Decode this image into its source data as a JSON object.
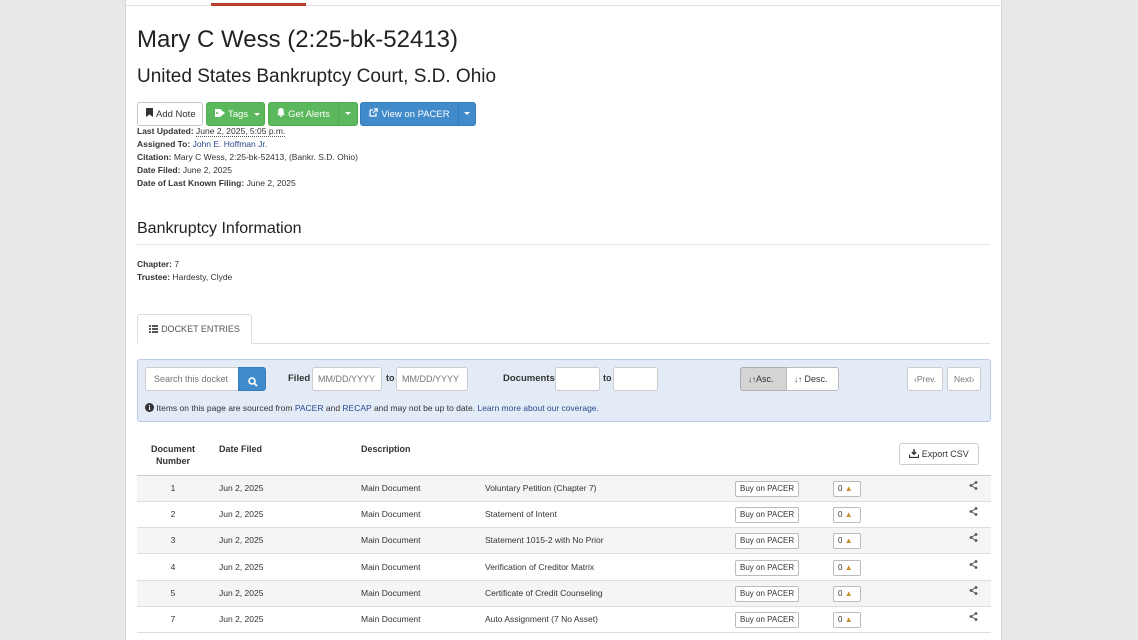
{
  "case": {
    "title": "Mary C Wess (2:25-bk-52413)",
    "court": "United States Bankruptcy Court, S.D. Ohio"
  },
  "buttons": {
    "add_note": "Add Note",
    "tags": "Tags",
    "get_alerts": "Get Alerts",
    "view_on_pacer": "View on PACER"
  },
  "meta": {
    "last_updated_label": "Last Updated:",
    "last_updated": "June 2, 2025, 5:05 p.m.",
    "assigned_label": "Assigned To:",
    "assigned": "John E. Hoffman Jr.",
    "citation_label": "Citation:",
    "citation": "Mary C Wess, 2:25-bk-52413, (Bankr. S.D. Ohio)",
    "date_filed_label": "Date Filed:",
    "date_filed": "June 2, 2025",
    "last_filing_label": "Date of Last Known Filing:",
    "last_filing": "June 2, 2025"
  },
  "bankruptcy": {
    "heading": "Bankruptcy Information",
    "chapter_label": "Chapter:",
    "chapter": "7",
    "trustee_label": "Trustee:",
    "trustee": "Hardesty, Clyde"
  },
  "tab": {
    "label": "DOCKET ENTRIES"
  },
  "filters": {
    "search_placeholder": "Search this docket",
    "filed_label": "Filed",
    "date_placeholder": "MM/DD/YYYY",
    "to_label": "to",
    "documents_label": "Documents",
    "asc": "Asc.",
    "desc": "Desc.",
    "prev": "Prev.",
    "next": "Next",
    "notice_pre": "Items on this page are sourced from",
    "notice_pacer": "PACER",
    "notice_and": "and",
    "notice_recap": "RECAP",
    "notice_post": "and may not be up to date.",
    "notice_link": "Learn more about our coverage."
  },
  "table": {
    "headers": {
      "doc_number_1": "Document",
      "doc_number_2": "Number",
      "date_filed": "Date Filed",
      "description": "Description"
    },
    "export": "Export CSV",
    "buy_label": "Buy on PACER",
    "tag_count": "0",
    "rows": [
      {
        "num": "1",
        "date": "Jun 2, 2025",
        "doc": "Main Document",
        "desc": "Voluntary Petition (Chapter 7)"
      },
      {
        "num": "2",
        "date": "Jun 2, 2025",
        "doc": "Main Document",
        "desc": "Statement of Intent"
      },
      {
        "num": "3",
        "date": "Jun 2, 2025",
        "doc": "Main Document",
        "desc": "Statement 1015-2 with No Prior"
      },
      {
        "num": "4",
        "date": "Jun 2, 2025",
        "doc": "Main Document",
        "desc": "Verification of Creditor Matrix"
      },
      {
        "num": "5",
        "date": "Jun 2, 2025",
        "doc": "Main Document",
        "desc": "Certificate of Credit Counseling"
      },
      {
        "num": "7",
        "date": "Jun 2, 2025",
        "doc": "Main Document",
        "desc": "Auto Assignment (7 No Asset)"
      }
    ]
  },
  "colors": {
    "green": "#5cb85c",
    "blue": "#428bca",
    "accent_red": "#b53f2a",
    "filter_bg": "#e3ebf7"
  }
}
